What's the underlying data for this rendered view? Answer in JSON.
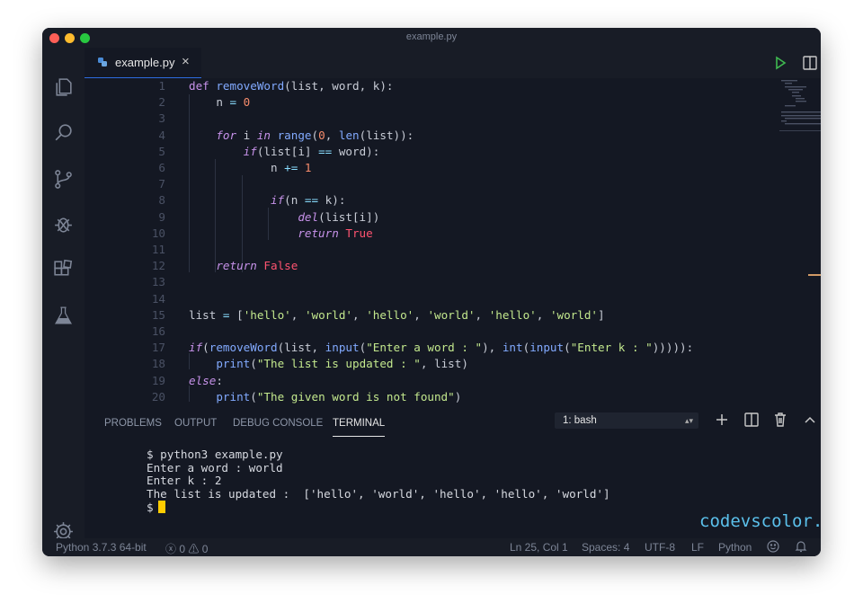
{
  "window": {
    "title": "example.py"
  },
  "tab": {
    "filename": "example.py",
    "close": "×"
  },
  "code": {
    "lines": [
      {
        "n": "1",
        "parts": [
          [
            "kw",
            "def "
          ],
          [
            "fn",
            "removeWord"
          ],
          [
            "",
            "(list, word, k):"
          ]
        ]
      },
      {
        "n": "2",
        "parts": [
          [
            "",
            "    n "
          ],
          [
            "op",
            "= "
          ],
          [
            "num",
            "0"
          ]
        ]
      },
      {
        "n": "3",
        "parts": []
      },
      {
        "n": "4",
        "parts": [
          [
            "kwi",
            "    for"
          ],
          [
            "",
            " i "
          ],
          [
            "kwi",
            "in "
          ],
          [
            "fn",
            "range"
          ],
          [
            "",
            "("
          ],
          [
            "num",
            "0"
          ],
          [
            "",
            ", "
          ],
          [
            "fn",
            "len"
          ],
          [
            "",
            "(list)):"
          ]
        ]
      },
      {
        "n": "5",
        "parts": [
          [
            "kwi",
            "        if"
          ],
          [
            "",
            "(list[i] "
          ],
          [
            "op",
            "== "
          ],
          [
            "",
            "word):"
          ]
        ]
      },
      {
        "n": "6",
        "parts": [
          [
            "",
            "            n "
          ],
          [
            "op",
            "+= "
          ],
          [
            "num",
            "1"
          ]
        ]
      },
      {
        "n": "7",
        "parts": []
      },
      {
        "n": "8",
        "parts": [
          [
            "kwi",
            "            if"
          ],
          [
            "",
            "(n "
          ],
          [
            "op",
            "== "
          ],
          [
            "",
            "k):"
          ]
        ]
      },
      {
        "n": "9",
        "parts": [
          [
            "kwi",
            "                del"
          ],
          [
            "",
            "(list[i])"
          ]
        ]
      },
      {
        "n": "10",
        "parts": [
          [
            "kwi",
            "                return "
          ],
          [
            "bool",
            "True"
          ]
        ]
      },
      {
        "n": "11",
        "parts": []
      },
      {
        "n": "12",
        "parts": [
          [
            "kwi",
            "    return "
          ],
          [
            "bool",
            "False"
          ]
        ]
      },
      {
        "n": "13",
        "parts": []
      },
      {
        "n": "14",
        "parts": []
      },
      {
        "n": "15",
        "parts": [
          [
            "",
            "list "
          ],
          [
            "op",
            "= "
          ],
          [
            "",
            "["
          ],
          [
            "str",
            "'hello'"
          ],
          [
            "",
            ", "
          ],
          [
            "str",
            "'world'"
          ],
          [
            "",
            ", "
          ],
          [
            "str",
            "'hello'"
          ],
          [
            "",
            ", "
          ],
          [
            "str",
            "'world'"
          ],
          [
            "",
            ", "
          ],
          [
            "str",
            "'hello'"
          ],
          [
            "",
            ", "
          ],
          [
            "str",
            "'world'"
          ],
          [
            "",
            "]"
          ]
        ]
      },
      {
        "n": "16",
        "parts": []
      },
      {
        "n": "17",
        "parts": [
          [
            "kwi",
            "if"
          ],
          [
            "",
            "("
          ],
          [
            "fn",
            "removeWord"
          ],
          [
            "",
            "(list, "
          ],
          [
            "fn",
            "input"
          ],
          [
            "",
            "("
          ],
          [
            "str",
            "\"Enter a word : \""
          ],
          [
            "",
            "), "
          ],
          [
            "fn",
            "int"
          ],
          [
            "",
            "("
          ],
          [
            "fn",
            "input"
          ],
          [
            "",
            "("
          ],
          [
            "str",
            "\"Enter k : \""
          ],
          [
            "",
            "))))):"
          ]
        ]
      },
      {
        "n": "18",
        "parts": [
          [
            "fn",
            "    print"
          ],
          [
            "",
            "("
          ],
          [
            "str",
            "\"The list is updated : \""
          ],
          [
            "",
            ", list)"
          ]
        ]
      },
      {
        "n": "19",
        "parts": [
          [
            "kwi",
            "else"
          ],
          [
            "",
            ":"
          ]
        ]
      },
      {
        "n": "20",
        "parts": [
          [
            "fn",
            "    print"
          ],
          [
            "",
            "("
          ],
          [
            "str",
            "\"The given word is not found\""
          ],
          [
            "",
            ")"
          ]
        ]
      }
    ]
  },
  "panel": {
    "tabs": [
      "PROBLEMS",
      "OUTPUT",
      "DEBUG CONSOLE",
      "TERMINAL"
    ],
    "active_tab": "TERMINAL",
    "terminal_select": "1: bash",
    "terminal_lines": [
      "$ python3 example.py",
      "Enter a word : world",
      "Enter k : 2",
      "The list is updated :  ['hello', 'world', 'hello', 'hello', 'world']"
    ],
    "prompt": "$",
    "watermark": "codevscolor.co"
  },
  "status": {
    "python": "Python 3.7.3 64-bit",
    "errors": "0",
    "warnings": "0",
    "position": "Ln 25, Col 1",
    "spaces": "Spaces: 4",
    "encoding": "UTF-8",
    "eol": "LF",
    "language": "Python"
  },
  "colors": {
    "accent": "#2d6cdf",
    "background": "#141823",
    "cursor": "#ffcc00",
    "watermark": "#5bc0eb"
  }
}
